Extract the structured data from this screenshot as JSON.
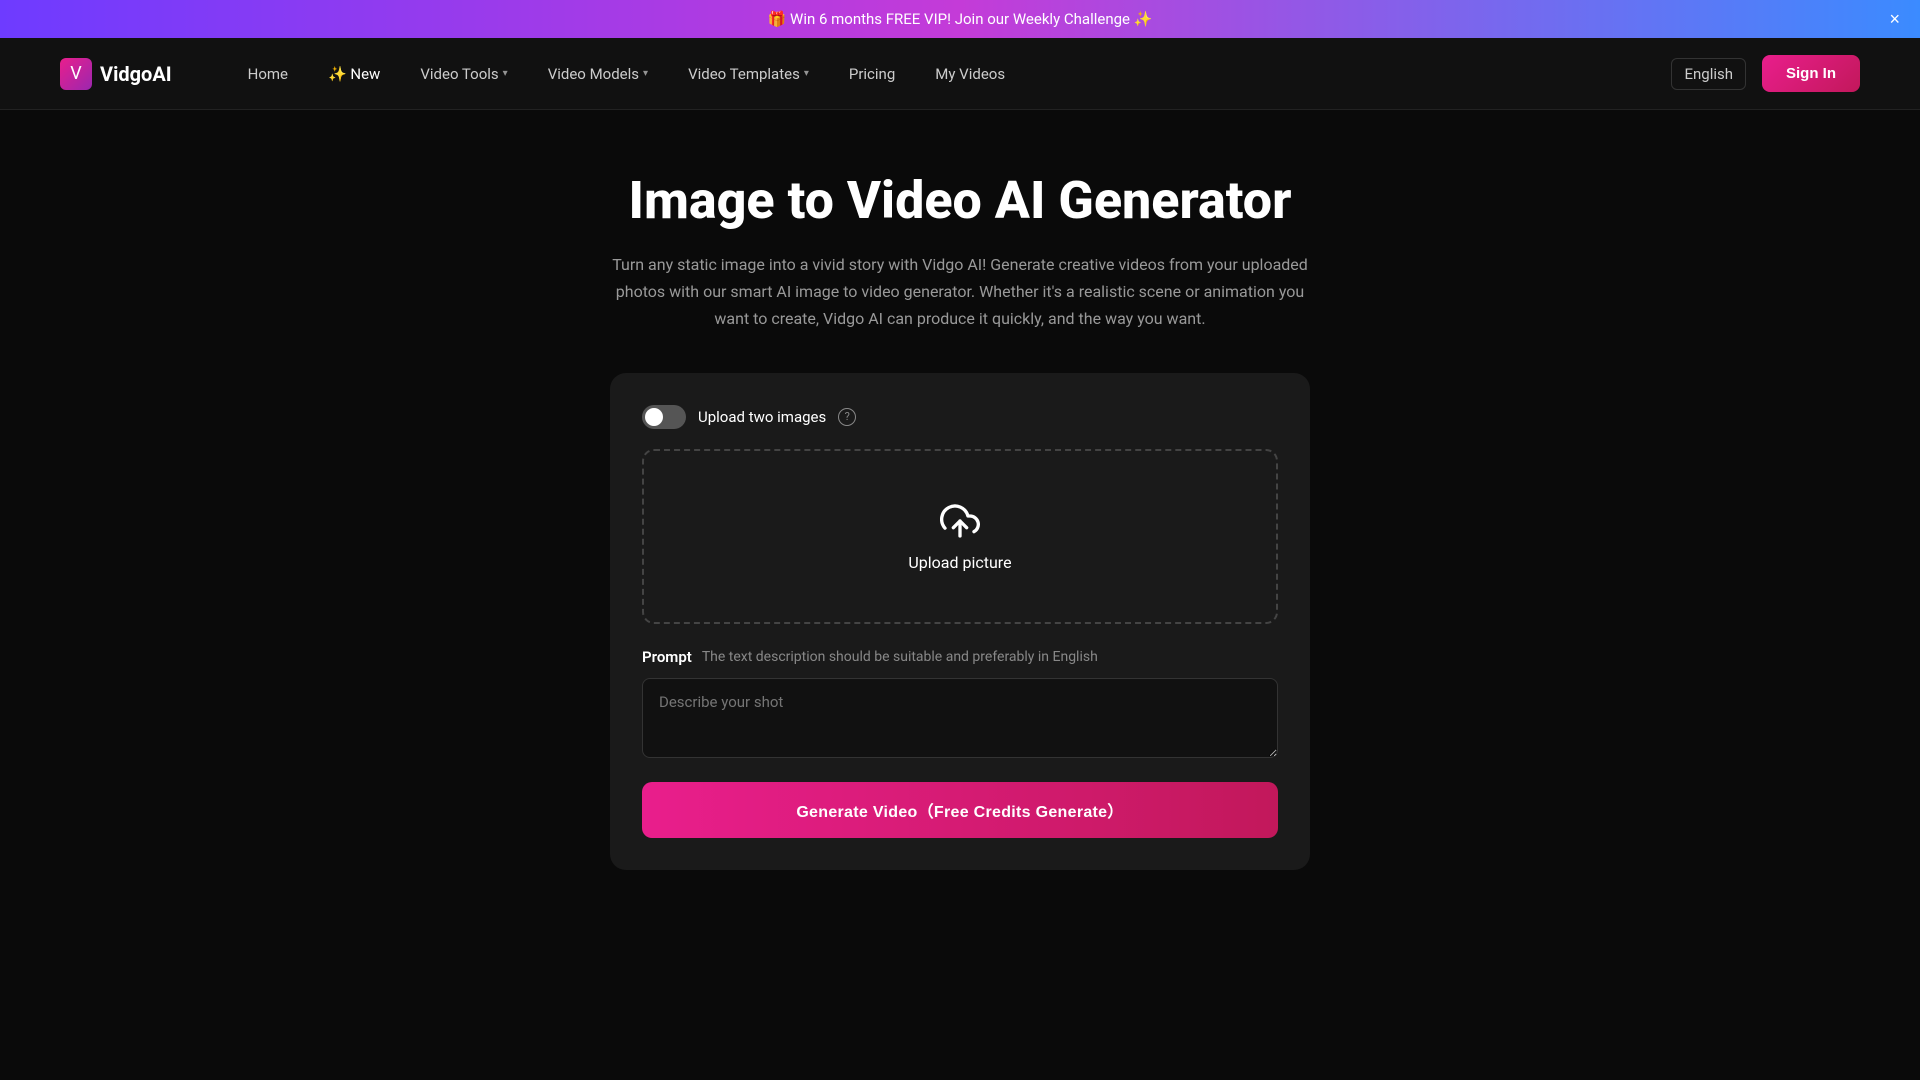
{
  "banner": {
    "text": "🎁 Win 6 months FREE VIP! Join our Weekly Challenge ✨",
    "close_label": "×"
  },
  "navbar": {
    "logo_text": "VidgoAI",
    "logo_icon": "V",
    "nav_items": [
      {
        "label": "Home",
        "has_dropdown": false
      },
      {
        "label": "✨ New",
        "has_dropdown": false
      },
      {
        "label": "Video Tools",
        "has_dropdown": true
      },
      {
        "label": "Video Models",
        "has_dropdown": true
      },
      {
        "label": "Video Templates",
        "has_dropdown": true
      },
      {
        "label": "Pricing",
        "has_dropdown": false
      },
      {
        "label": "My Videos",
        "has_dropdown": false
      }
    ],
    "language": "English",
    "sign_in_label": "Sign In"
  },
  "page": {
    "title": "Image to Video AI Generator",
    "description": "Turn any static image into a vivid story with Vidgo AI! Generate creative videos from your uploaded photos with our smart AI image to video generator. Whether it's a realistic scene or animation you want to create, Vidgo AI can produce it quickly, and the way you want."
  },
  "card": {
    "toggle_label": "Upload two images",
    "upload_label": "Upload picture",
    "prompt_label": "Prompt",
    "prompt_hint": "The text description should be suitable and preferably in English",
    "prompt_placeholder": "Describe your shot",
    "generate_button_label": "Generate Video（Free Credits Generate）"
  }
}
